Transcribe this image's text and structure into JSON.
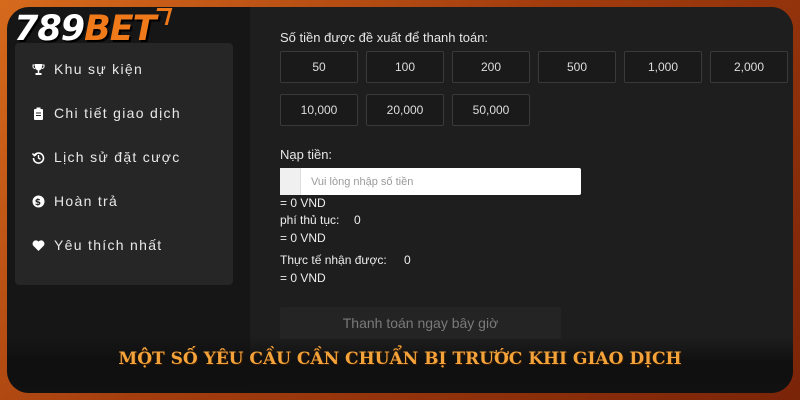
{
  "logo": {
    "part1": "789",
    "part2": "BET"
  },
  "sidebar": {
    "items": [
      {
        "label": "Khu sự kiện",
        "icon": "trophy-icon"
      },
      {
        "label": "Chi tiết giao dịch",
        "icon": "clipboard-icon"
      },
      {
        "label": "Lịch sử đặt cược",
        "icon": "history-icon"
      },
      {
        "label": "Hoàn trả",
        "icon": "dollar-coin-icon"
      },
      {
        "label": "Yêu thích nhất",
        "icon": "heart-icon"
      }
    ]
  },
  "main": {
    "suggested_label": "Số tiền được đề xuất để thanh toán:",
    "amounts": [
      "50",
      "100",
      "200",
      "500",
      "1,000",
      "2,000",
      "10,000",
      "20,000",
      "50,000"
    ],
    "deposit_label": "Nạp tiền:",
    "deposit_placeholder": "Vui lòng nhập số tiền",
    "deposit_converted": "= 0 VND",
    "fee_label": "phí thủ tục:",
    "fee_value": "0",
    "fee_converted": "= 0 VND",
    "actual_label": "Thực tế nhận được:",
    "actual_value": "0",
    "actual_converted": "= 0 VND",
    "pay_button": "Thanh toán ngay bây giờ"
  },
  "banner": {
    "text": "MỘT SỐ YÊU CẦU CẦN CHUẨN BỊ TRƯỚC KHI GIAO DỊCH"
  },
  "colors": {
    "accent": "#f07a1a",
    "banner_text": "#f3a33a",
    "panel": "#262626"
  }
}
